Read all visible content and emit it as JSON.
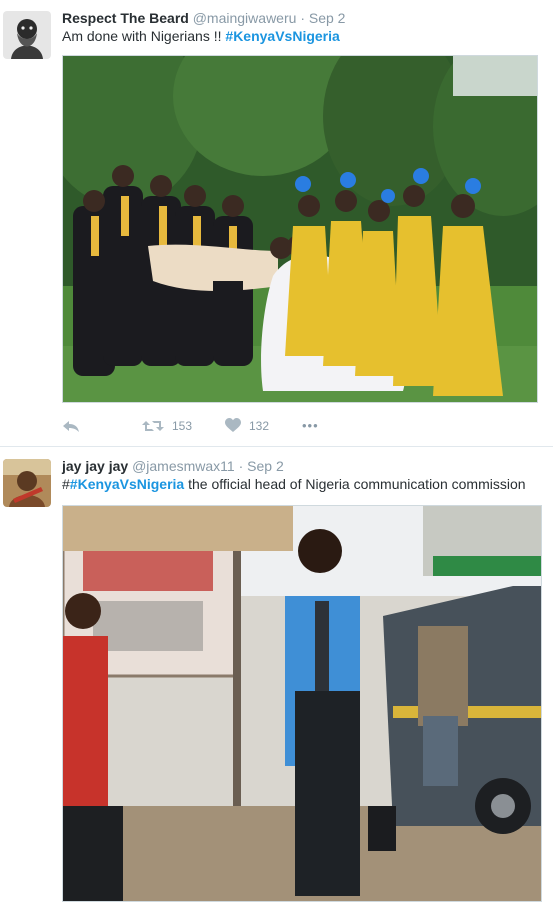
{
  "tweets": [
    {
      "name": "Respect The Beard",
      "handle": "@maingiwaweru",
      "dot": "·",
      "date": "Sep 2",
      "text_prefix": "Am done with Nigerians !! ",
      "hashtag": "#KenyaVsNigeria",
      "text_suffix": "",
      "retweets": "153",
      "likes": "132",
      "more": "•••"
    },
    {
      "name": "jay jay jay",
      "handle": "@jamesmwax11",
      "dot": "·",
      "date": "Sep 2",
      "text_prefix": "#",
      "hashtag": "#KenyaVsNigeria",
      "text_suffix": " the official head  of Nigeria communication commission"
    }
  ],
  "colors": {
    "link": "#1b95e0",
    "meta": "#8899a6",
    "action_icon": "#aab8c2"
  },
  "icons": [
    "reply-icon",
    "retweet-icon",
    "like-heart-icon",
    "more-dots-icon"
  ]
}
